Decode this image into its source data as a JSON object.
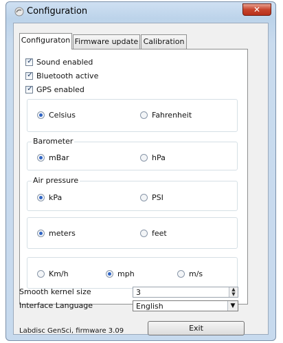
{
  "window": {
    "title": "Configuration",
    "close_label": "✕"
  },
  "tabs": [
    {
      "label": "Configuraton"
    },
    {
      "label": "Firmware update"
    },
    {
      "label": "Calibration"
    }
  ],
  "checkboxes": [
    {
      "label": "Sound enabled",
      "checked": true
    },
    {
      "label": "Bluetooth active",
      "checked": true
    },
    {
      "label": "GPS enabled",
      "checked": true
    }
  ],
  "temperature": {
    "options": [
      "Celsius",
      "Fahrenheit"
    ],
    "selected": "Celsius"
  },
  "barometer": {
    "label": "Barometer",
    "options": [
      "mBar",
      "hPa"
    ],
    "selected": "mBar"
  },
  "air_pressure": {
    "label": "Air pressure",
    "options": [
      "kPa",
      "PSI"
    ],
    "selected": "kPa"
  },
  "distance": {
    "options": [
      "meters",
      "feet"
    ],
    "selected": "meters"
  },
  "speed": {
    "options": [
      "Km/h",
      "mph",
      "m/s"
    ],
    "selected": "mph"
  },
  "smooth_kernel": {
    "label": "Smooth kernel size",
    "value": "3"
  },
  "language": {
    "label": "Interface Language",
    "value": "English"
  },
  "status": {
    "text": "Labdisc GenSci, firmware 3.09"
  },
  "exit_button": {
    "label": "Exit"
  },
  "icons": {
    "title": "app-swirl-icon",
    "checkmark": "✓",
    "spin": "▲▼",
    "dropdown": "▼"
  },
  "colors": {
    "accent": "#2f64c4",
    "close": "#c7442c",
    "frame": "#c7daee"
  }
}
